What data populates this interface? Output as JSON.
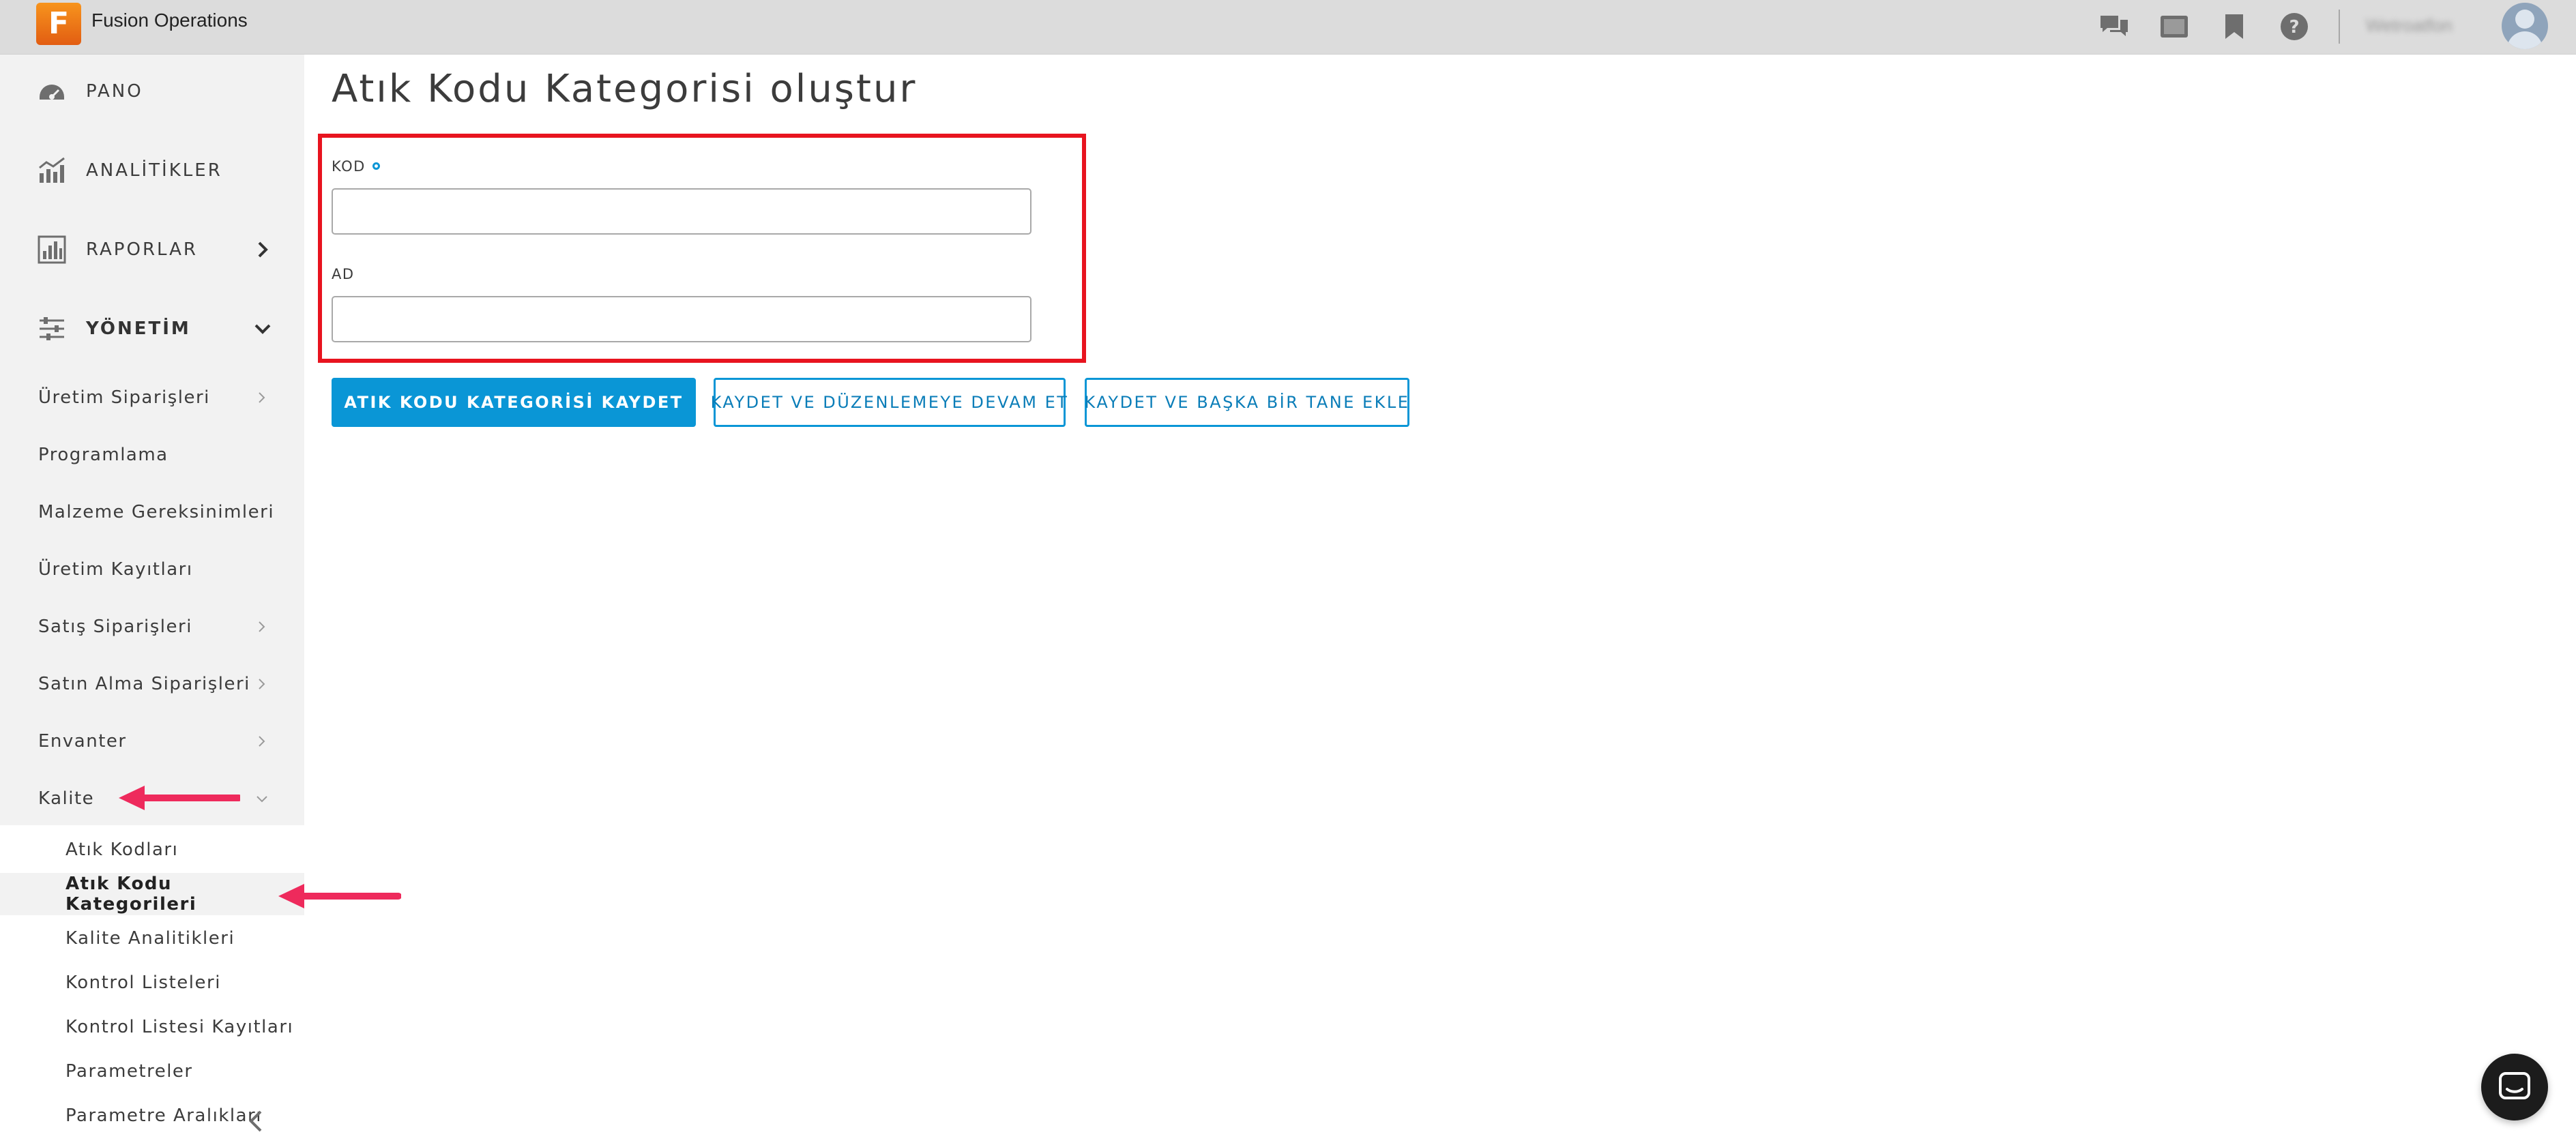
{
  "app": {
    "logo_letter": "F",
    "name": "Fusion Operations"
  },
  "topbar": {
    "icons": [
      "chat-icon",
      "tablet-icon",
      "bookmark-icon",
      "help-icon"
    ],
    "username": "Wetroatfon"
  },
  "sidebar": {
    "main": [
      {
        "label": "PANO",
        "icon": "dashboard-icon"
      },
      {
        "label": "ANALİTİKLER",
        "icon": "analytics-icon"
      },
      {
        "label": "RAPORLAR",
        "icon": "reports-icon",
        "chevron": "right"
      },
      {
        "label": "YÖNETİM",
        "icon": "sliders-icon",
        "chevron": "down"
      }
    ],
    "items": [
      {
        "label": "Üretim Siparişleri",
        "chevron": true
      },
      {
        "label": "Programlama",
        "chevron": false
      },
      {
        "label": "Malzeme Gereksinimleri",
        "chevron": false
      },
      {
        "label": "Üretim Kayıtları",
        "chevron": false
      },
      {
        "label": "Satış Siparişleri",
        "chevron": true
      },
      {
        "label": "Satın Alma Siparişleri",
        "chevron": true
      },
      {
        "label": "Envanter",
        "chevron": true
      },
      {
        "label": "Kalite",
        "chevron": true
      }
    ],
    "quality_sub": [
      {
        "label": "Atık Kodları"
      },
      {
        "label": "Atık Kodu Kategorileri",
        "active": true
      },
      {
        "label": "Kalite Analitikleri"
      },
      {
        "label": "Kontrol Listeleri"
      },
      {
        "label": "Kontrol Listesi Kayıtları"
      },
      {
        "label": "Parametreler"
      },
      {
        "label": "Parametre Aralıkları"
      }
    ]
  },
  "main": {
    "title": "Atık Kodu Kategorisi oluştur",
    "form": {
      "code_label": "KOD",
      "code_value": "",
      "name_label": "AD",
      "name_value": ""
    },
    "buttons": {
      "save": "ATIK KODU KATEGORİSİ KAYDET",
      "save_continue": "KAYDET VE DÜZENLEMEYE DEVAM ET",
      "save_add": "KAYDET VE BAŞKA BİR TANE EKLE"
    }
  },
  "colors": {
    "accent": "#0a96d6",
    "highlight_box": "#e8141f",
    "annotation_arrow": "#ee2a5c",
    "topbar": "#dcdcdc",
    "sidebar": "#f2f2f2"
  }
}
